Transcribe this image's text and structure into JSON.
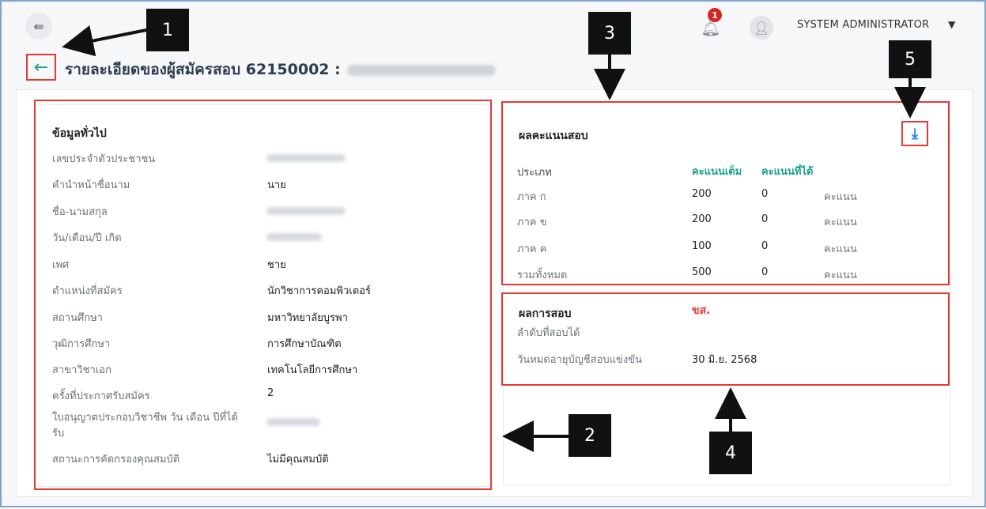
{
  "topbar": {
    "menu_icon": "collapse-menu-icon",
    "bell_badge": "1",
    "user_name": "SYSTEM ADMINISTRATOR",
    "caret": "▼"
  },
  "page": {
    "back_icon": "←",
    "title": "รายละเอียดของผู้สมัครสอบ 62150002 :"
  },
  "general": {
    "title": "ข้อมูลทั่วไป",
    "rows": [
      {
        "label": "เลขประจำตัวประชาชน",
        "value": ""
      },
      {
        "label": "คำนำหน้าชื่อนาม",
        "value": "นาย"
      },
      {
        "label": "ชื่อ-นามสกุล",
        "value": ""
      },
      {
        "label": "วัน/เดือน/ปี เกิด",
        "value": ""
      },
      {
        "label": "เพศ",
        "value": "ชาย"
      },
      {
        "label": "ตำแหน่งที่สมัคร",
        "value": "นักวิชาการคอมพิวเตอร์"
      },
      {
        "label": "สถานศึกษา",
        "value": "มหาวิทยาลัยบูรพา"
      },
      {
        "label": "วุฒิการศึกษา",
        "value": "การศึกษาบัณฑิต"
      },
      {
        "label": "สาขาวิชาเอก",
        "value": "เทคโนโลยีการศึกษา"
      },
      {
        "label": "ครั้งที่ประกาศรับสมัคร",
        "value": "2"
      },
      {
        "label": "ใบอนุญาตประกอบวิชาชีพ วัน เดือน ปีที่ได้รับ",
        "value": ""
      },
      {
        "label": "สถานะการคัดกรองคุณสมบัติ",
        "value": "ไม่มีคุณสมบัติ"
      }
    ]
  },
  "scores": {
    "title": "ผลคะแนนสอบ",
    "col_type": "ประเภท",
    "col_full": "คะแนนเต็ม",
    "col_got": "คะแนนที่ได้",
    "rows": [
      {
        "type": "ภาค ก",
        "full": "200",
        "got": "0",
        "unit": "คะแนน"
      },
      {
        "type": "ภาค ข",
        "full": "200",
        "got": "0",
        "unit": "คะแนน"
      },
      {
        "type": "ภาค ค",
        "full": "100",
        "got": "0",
        "unit": "คะแนน"
      },
      {
        "type": "รวมทั้งหมด",
        "full": "500",
        "got": "0",
        "unit": "คะแนน"
      }
    ],
    "download_icon": "download-icon"
  },
  "result": {
    "title": "ผลการสอบ",
    "status": "ขส.",
    "rank_label": "ลำดับที่สอบได้",
    "rank_value": "",
    "expiry_label": "วันหมดอายุบัญชีสอบแข่งขัน",
    "expiry_value": "30 มิ.ย. 2568"
  },
  "callouts": [
    "1",
    "2",
    "3",
    "4",
    "5"
  ],
  "colors": {
    "accent_green": "#1aa38d",
    "highlight_red": "#e53935",
    "download_blue": "#1e88e5"
  }
}
